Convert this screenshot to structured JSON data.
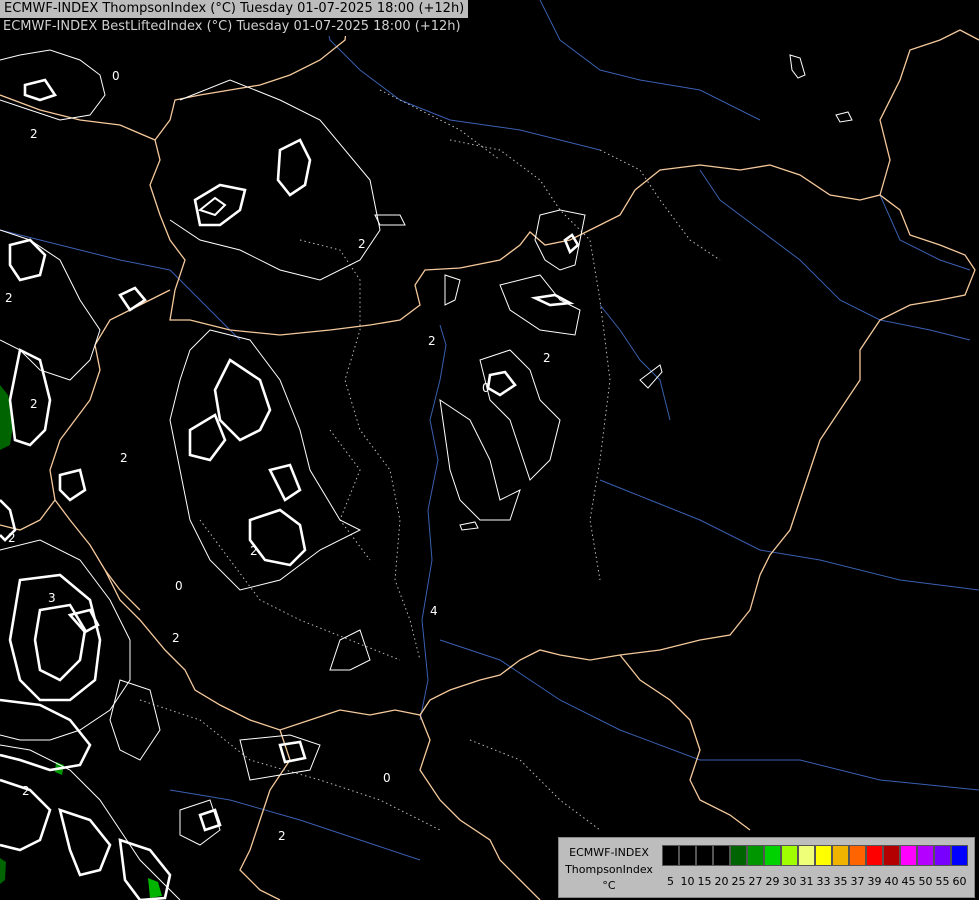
{
  "titles": {
    "line1": "ECMWF-INDEX ThompsonIndex (°C) Tuesday 01-07-2025 18:00 (+12h)",
    "line2": "ECMWF-INDEX BestLiftedIndex (°C) Tuesday 01-07-2025 18:00 (+12h)"
  },
  "legend": {
    "model": "ECMWF-INDEX",
    "parameter": "ThompsonIndex",
    "unit": "°C",
    "scale": [
      {
        "label": "5",
        "color": "#000000"
      },
      {
        "label": "10",
        "color": "#000000"
      },
      {
        "label": "15",
        "color": "#000000"
      },
      {
        "label": "20",
        "color": "#000000"
      },
      {
        "label": "25",
        "color": "#006400"
      },
      {
        "label": "27",
        "color": "#009600"
      },
      {
        "label": "29",
        "color": "#00d200"
      },
      {
        "label": "30",
        "color": "#a0ff00"
      },
      {
        "label": "31",
        "color": "#f0ff78"
      },
      {
        "label": "33",
        "color": "#ffff00"
      },
      {
        "label": "35",
        "color": "#f0b400"
      },
      {
        "label": "37",
        "color": "#ff6400"
      },
      {
        "label": "39",
        "color": "#ff0000"
      },
      {
        "label": "40",
        "color": "#b40000"
      },
      {
        "label": "45",
        "color": "#ff00ff"
      },
      {
        "label": "50",
        "color": "#b400ff"
      },
      {
        "label": "55",
        "color": "#7800ff"
      },
      {
        "label": "60",
        "color": "#0000ff"
      }
    ]
  },
  "contour_labels": [
    {
      "text": "2"
    },
    {
      "text": "0"
    },
    {
      "text": "2"
    },
    {
      "text": "2"
    },
    {
      "text": "2"
    },
    {
      "text": "2"
    },
    {
      "text": "2"
    },
    {
      "text": "0"
    },
    {
      "text": "4"
    },
    {
      "text": "2"
    },
    {
      "text": "2"
    },
    {
      "text": "0"
    },
    {
      "text": "2"
    },
    {
      "text": "2"
    },
    {
      "text": "3"
    },
    {
      "text": "2"
    },
    {
      "text": "0"
    },
    {
      "text": "2"
    }
  ],
  "colors": {
    "background": "#000000",
    "border": "#f5c99b",
    "river": "#3a5fb0",
    "contour_solid": "#ffffff",
    "contour_dotted": "#bbbbbb",
    "fill_green": "#006400"
  }
}
